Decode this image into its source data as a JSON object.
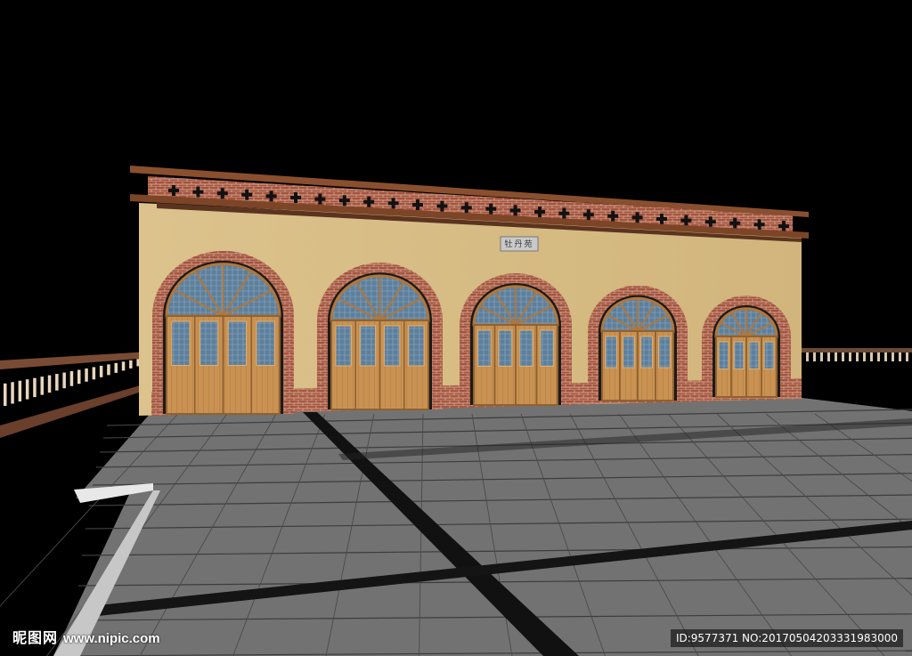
{
  "building": {
    "sign_text": "牡丹苑",
    "arch_count": 5
  },
  "watermark": {
    "brand": "昵图网",
    "site": "www.nipic.com",
    "id_text": "ID:9577371 NO:20170504203331983000"
  },
  "colors": {
    "background": "#000000",
    "wall": "#d8bd86",
    "brick": "#a5533f",
    "roof_wood": "#8a4f2e",
    "door_wood": "#c9934f",
    "glass": "#5b7d9a",
    "pavement": "#6e6e6e"
  }
}
